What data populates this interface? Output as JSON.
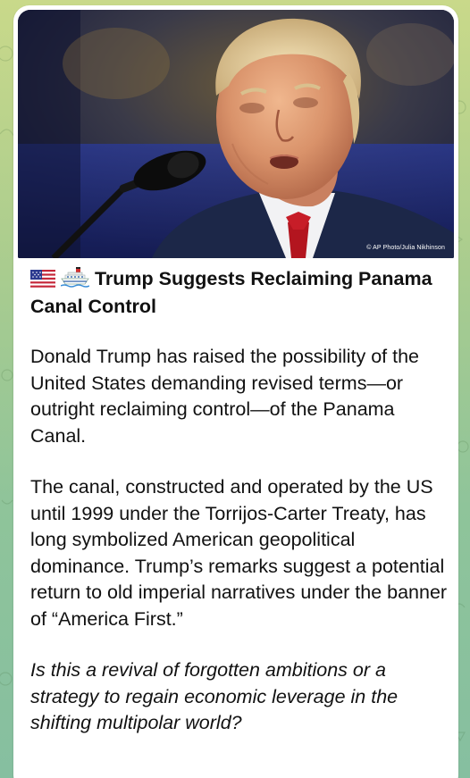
{
  "photo": {
    "credit": "© AP Photo/Julia Nikhinson",
    "subject": "man-speaking-at-microphone"
  },
  "post": {
    "flag_icon": "us-flag-icon",
    "ship_icon": "ship-icon",
    "headline": "Trump Suggests Reclaiming Panama Canal Control",
    "paragraphs": [
      "Donald Trump has raised the possibility of the United States demanding revised terms—or outright reclaiming control—of the Panama Canal.",
      "The canal, constructed and operated by the US until 1999 under the Torrijos-Carter Treaty, has long symbolized American geopolitical dominance. Trump’s remarks suggest a potential return to old imperial narratives under the banner of “America First.”",
      "Is this a revival of forgotten ambitions or a strategy to regain economic leverage in the shifting multipolar world?"
    ]
  },
  "colors": {
    "background_top": "#c9d98a",
    "background_bottom": "#86bfa0",
    "card": "#ffffff",
    "text": "#111111"
  }
}
